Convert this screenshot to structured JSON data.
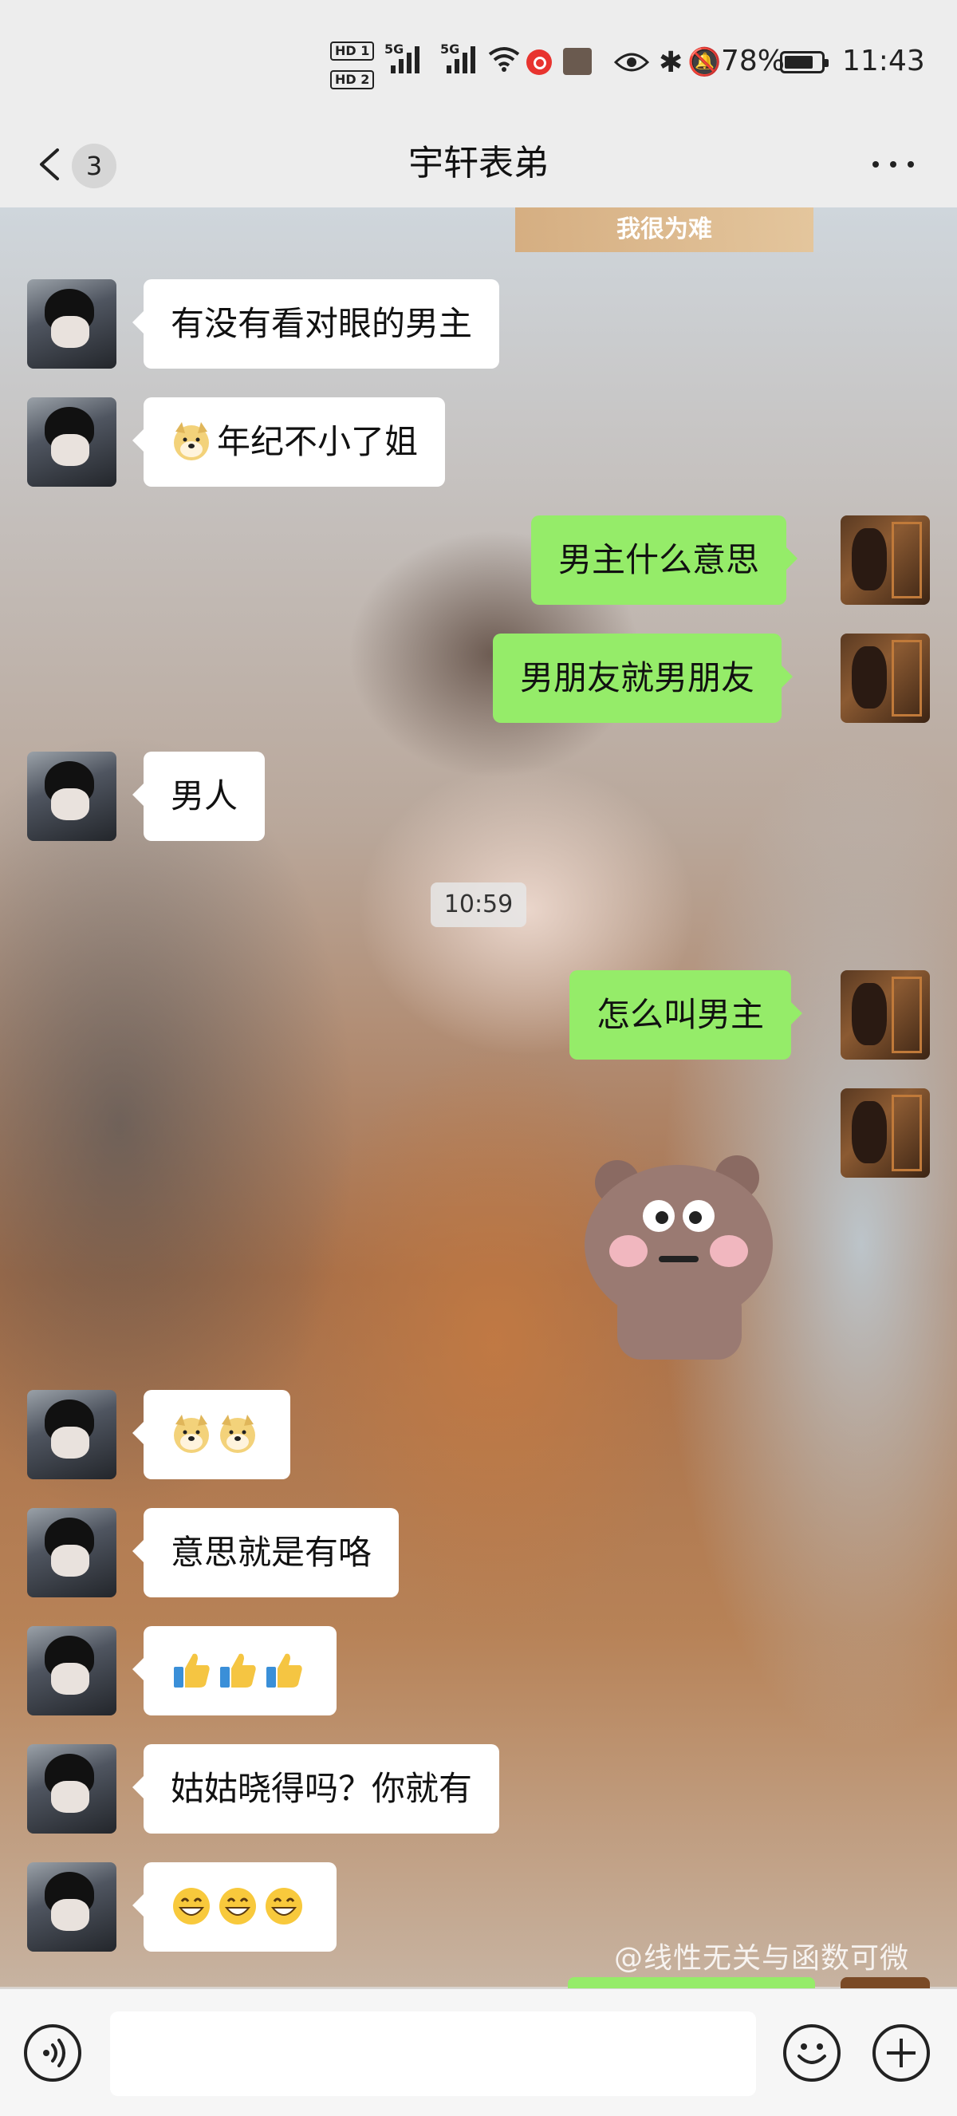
{
  "status_bar": {
    "hd1": "HD 1",
    "hd2": "HD 2",
    "net1": "5G",
    "net2": "5G",
    "battery_percent": "78%",
    "time": "11:43",
    "icons": [
      "wifi-icon",
      "screen-record-icon",
      "app-notification-icon",
      "eye-icon",
      "bluetooth-icon",
      "mute-bell-icon",
      "battery-icon"
    ]
  },
  "header": {
    "unread_count": "3",
    "title": "宇轩表弟",
    "more_icon": "more-dots-icon",
    "back_icon": "chevron-left-icon"
  },
  "wallpaper": {
    "caption": "我很为难",
    "watermark": "@线性无关与函数可微"
  },
  "messages": [
    {
      "side": "in",
      "text": "有没有看对眼的男主"
    },
    {
      "side": "in",
      "emoji": "doge",
      "text": "年纪不小了姐"
    },
    {
      "side": "out",
      "text": "男主什么意思"
    },
    {
      "side": "out",
      "text": "男朋友就男朋友"
    },
    {
      "side": "in",
      "text": "男人"
    },
    {
      "side": "time",
      "text": "10:59"
    },
    {
      "side": "out",
      "text": "怎么叫男主"
    },
    {
      "side": "out",
      "sticker": "bear-sticker"
    },
    {
      "side": "in",
      "emoji_row": [
        "doge",
        "doge"
      ]
    },
    {
      "side": "in",
      "text": "意思就是有咯"
    },
    {
      "side": "in",
      "emoji_row": [
        "thumbs-up",
        "thumbs-up",
        "thumbs-up"
      ]
    },
    {
      "side": "in",
      "text": "姑姑晓得吗？你就有"
    },
    {
      "side": "in",
      "emoji_row": [
        "grin",
        "grin",
        "grin"
      ]
    }
  ],
  "input_bar": {
    "value": "",
    "placeholder": "",
    "icons": [
      "voice-icon",
      "emoji-icon",
      "plus-icon"
    ]
  },
  "colors": {
    "incoming_bubble": "#ffffff",
    "outgoing_bubble": "#95ec69",
    "bar_background": "#ededed"
  }
}
